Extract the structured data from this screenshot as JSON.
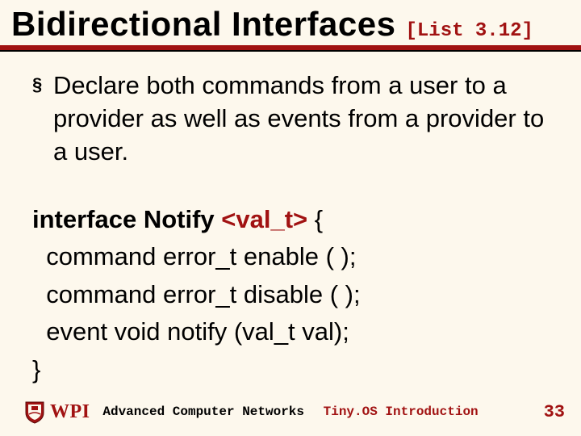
{
  "title": {
    "main": "Bidirectional Interfaces",
    "tag": "[List 3.12]"
  },
  "bullet": {
    "marker": "§",
    "text": "Declare both commands from a user to a provider as well as events from a provider to a user."
  },
  "code": {
    "l1_kw": "interface ",
    "l1_name": "Notify ",
    "l1_gen": "<val_t>",
    "l1_tail": " {",
    "l2": "  command error_t enable ( );",
    "l3": "  command error_t disable ( );",
    "l4": "  event void notify (val_t val);",
    "l5": "}"
  },
  "footer": {
    "left": "Advanced Computer Networks",
    "right": "Tiny.OS Introduction",
    "page": "33",
    "logo_text": "WPI"
  }
}
